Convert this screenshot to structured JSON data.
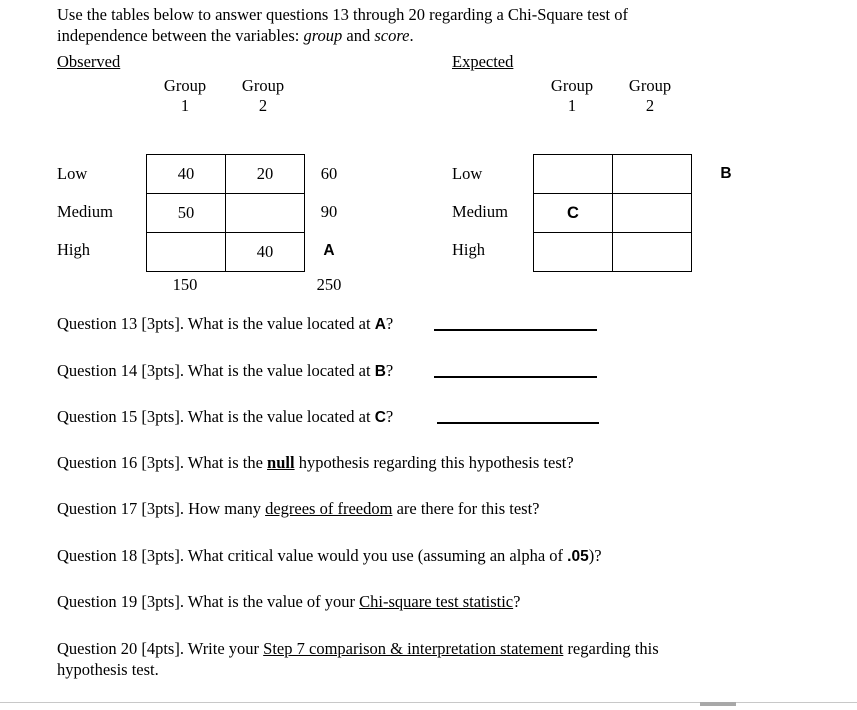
{
  "intro": {
    "line1_a": "Use the tables below to answer questions 13 through 20 regarding a Chi-Square test of",
    "line2_a": "independence between the variables: ",
    "var1": "group",
    "line2_b": " and ",
    "var2": "score",
    "line2_c": "."
  },
  "observed": {
    "caption": "Observed",
    "col_headers": [
      {
        "line1": "Group",
        "line2": "1"
      },
      {
        "line1": "Group",
        "line2": "2"
      }
    ],
    "row_labels": [
      "Low",
      "Medium",
      "High"
    ],
    "cells": [
      [
        "40",
        "20"
      ],
      [
        "50",
        ""
      ],
      [
        "",
        "40"
      ]
    ],
    "row_totals": [
      "60",
      "90",
      "A"
    ],
    "row_total_markers": [
      false,
      false,
      true
    ],
    "col_totals": [
      "150",
      ""
    ],
    "grand_total": "250"
  },
  "expected": {
    "caption": "Expected",
    "col_headers": [
      {
        "line1": "Group",
        "line2": "1"
      },
      {
        "line1": "Group",
        "line2": "2"
      }
    ],
    "row_labels": [
      "Low",
      "Medium",
      "High"
    ],
    "cells": [
      [
        "",
        ""
      ],
      [
        "C",
        ""
      ],
      [
        "",
        ""
      ]
    ],
    "cell_markers": [
      [
        false,
        false
      ],
      [
        true,
        false
      ],
      [
        false,
        false
      ]
    ],
    "row_totals": [
      "B",
      "",
      ""
    ],
    "row_total_markers": [
      true,
      false,
      false
    ],
    "col_totals": [
      "",
      ""
    ],
    "grand_total": ""
  },
  "questions": [
    {
      "number": "13",
      "prefix": "Question 13 [3pts]. What is the value located at ",
      "marker": "A",
      "suffix": "?",
      "has_answer_line": true
    },
    {
      "number": "14",
      "prefix": "Question 14 [3pts]. What is the value located at ",
      "marker": "B",
      "suffix": "?",
      "has_answer_line": true
    },
    {
      "number": "15",
      "prefix": "Question 15 [3pts]. What is the value located at ",
      "marker": "C",
      "suffix": "?",
      "has_answer_line": true
    },
    {
      "number": "16",
      "prefix": "Question 16 [3pts]. What is the ",
      "emphasis": "null",
      "suffix": " hypothesis regarding this hypothesis test?",
      "has_answer_line": false
    },
    {
      "number": "17",
      "prefix": "Question 17 [3pts]. How many ",
      "emphasis": "degrees of freedom",
      "suffix": " are there for this test?",
      "has_answer_line": false
    },
    {
      "number": "18",
      "prefix": "Question 18 [3pts]. What critical value would you use (assuming an alpha of ",
      "emphasis": ".05",
      "suffix": ")?",
      "has_answer_line": false
    },
    {
      "number": "19",
      "prefix": "Question 19 [3pts]. What is the value of your ",
      "emphasis": "Chi-square test statistic",
      "suffix": "?",
      "has_answer_line": false
    },
    {
      "number": "20",
      "prefix": "Question 20 [4pts]. Write your ",
      "emphasis": "Step 7 comparison & interpretation statement",
      "suffix": " regarding this hypothesis test.",
      "has_answer_line": false
    }
  ]
}
